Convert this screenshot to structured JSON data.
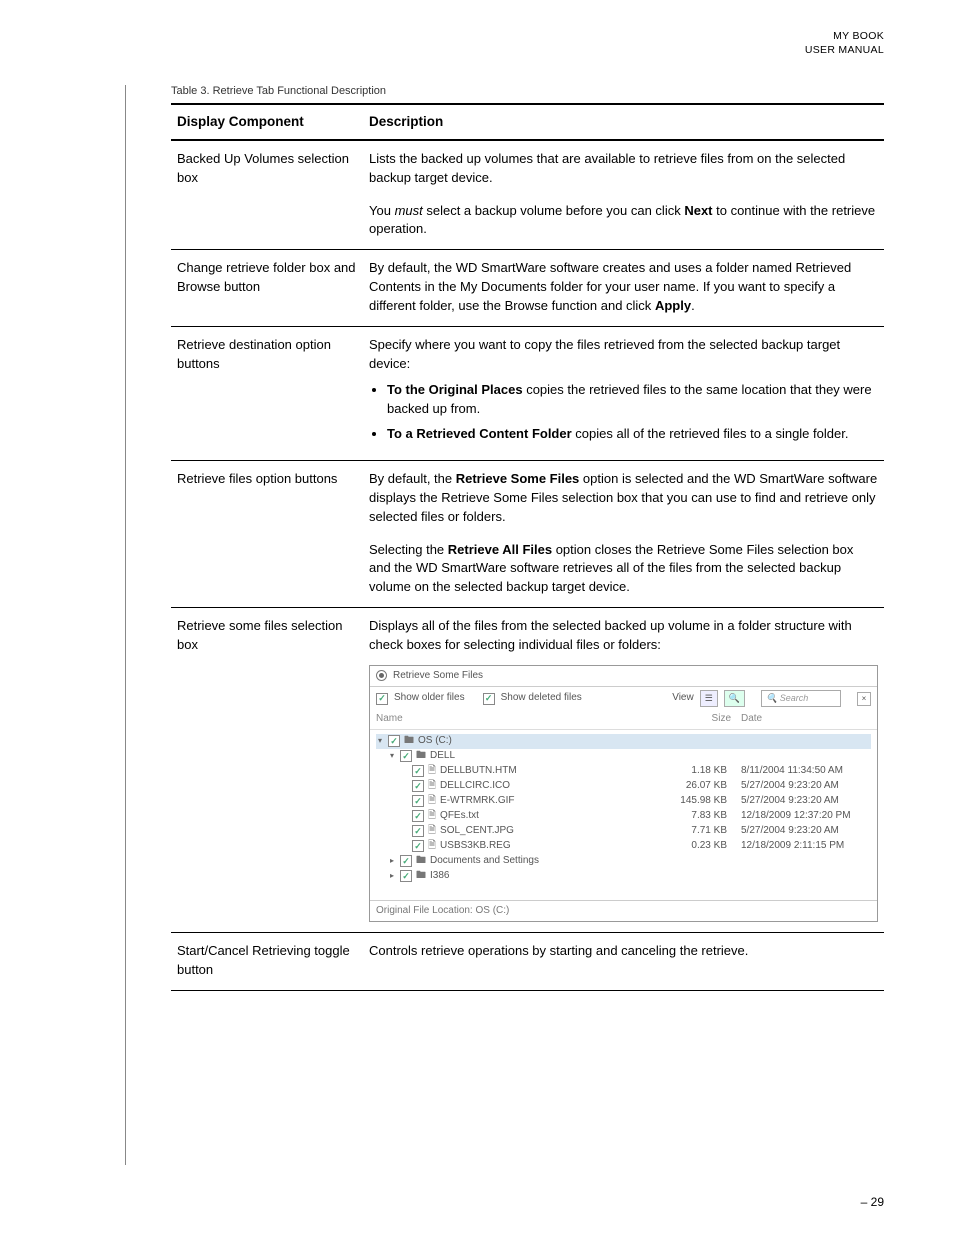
{
  "header": {
    "line1": "MY BOOK",
    "line2": "USER MANUAL"
  },
  "caption": "Table 3.  Retrieve Tab Functional Description",
  "th1": "Display Component",
  "th2": "Description",
  "rows": {
    "r1": {
      "c": "Backed Up Volumes selection box",
      "p1": "Lists the backed up volumes that are available to retrieve files from on the selected backup target device.",
      "p2a": "You ",
      "p2b": "must",
      "p2c": " select a backup volume before you can click ",
      "p2d": "Next",
      "p2e": " to continue with the retrieve operation."
    },
    "r2": {
      "c": "Change retrieve folder box and Browse button",
      "p1a": "By default, the WD SmartWare software creates and uses a folder named Retrieved Contents in the My Documents folder for your user name. If you want to specify a different folder, use the Browse function and click ",
      "p1b": "Apply",
      "p1c": "."
    },
    "r3": {
      "c": "Retrieve destination option buttons",
      "p1": "Specify where you want to copy the files retrieved from the selected backup target device:",
      "b1a": "To the Original Places",
      "b1b": " copies the retrieved files to the same location that they were backed up from.",
      "b2a": "To a Retrieved Content Folder",
      "b2b": " copies all of the retrieved files to a single folder."
    },
    "r4": {
      "c": "Retrieve files option buttons",
      "p1a": "By default, the ",
      "p1b": "Retrieve Some Files",
      "p1c": " option is selected and the WD SmartWare software displays the Retrieve Some Files selection box that you can use to find and retrieve only selected files or folders.",
      "p2a": "Selecting the ",
      "p2b": "Retrieve All Files",
      "p2c": " option closes the Retrieve Some Files selection box and the WD SmartWare software retrieves all of the files from the selected backup volume on the selected backup target device."
    },
    "r5": {
      "c": "Retrieve some files selection box",
      "p1": "Displays all of the files from the selected backed up volume in a folder structure with check boxes for selecting individual files or folders:"
    },
    "r6": {
      "c": "Start/Cancel Retrieving toggle button",
      "p1": "Controls retrieve operations by starting and canceling the retrieve."
    }
  },
  "panel": {
    "title": "Retrieve Some Files",
    "older": "Show older files",
    "deleted": "Show deleted files",
    "view": "View",
    "search": "Search",
    "cols": {
      "name": "Name",
      "size": "Size",
      "date": "Date"
    },
    "tree": {
      "root": "OS (C:)",
      "dell": "DELL",
      "files": [
        {
          "n": "DELLBUTN.HTM",
          "s": "1.18 KB",
          "d": "8/11/2004 11:34:50 AM"
        },
        {
          "n": "DELLCIRC.ICO",
          "s": "26.07 KB",
          "d": "5/27/2004 9:23:20 AM"
        },
        {
          "n": "E-WTRMRK.GIF",
          "s": "145.98 KB",
          "d": "5/27/2004 9:23:20 AM"
        },
        {
          "n": "QFEs.txt",
          "s": "7.83 KB",
          "d": "12/18/2009 12:37:20 PM"
        },
        {
          "n": "SOL_CENT.JPG",
          "s": "7.71 KB",
          "d": "5/27/2004 9:23:20 AM"
        },
        {
          "n": "USBS3KB.REG",
          "s": "0.23 KB",
          "d": "12/18/2009 2:11:15 PM"
        }
      ],
      "docs": "Documents and Settings",
      "i386": "I386"
    },
    "footer": "Original File Location:   OS (C:)"
  },
  "pagenum": "– 29"
}
